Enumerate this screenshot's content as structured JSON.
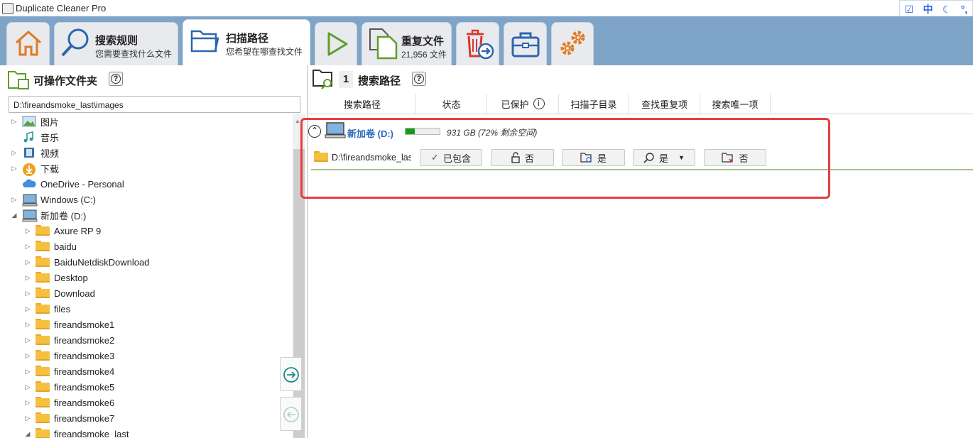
{
  "window": {
    "title": "Duplicate Cleaner Pro"
  },
  "ime": {
    "mode_label": "中"
  },
  "tabs": {
    "home": {
      "icon": "home-icon"
    },
    "search_rules": {
      "title": "搜索规则",
      "subtitle": "您需要查找什么文件",
      "icon": "search-icon"
    },
    "scan_paths": {
      "title": "扫描路径",
      "subtitle": "您希望在哪查找文件",
      "icon": "folder-open-icon"
    },
    "run": {
      "icon": "play-icon"
    },
    "duplicates": {
      "title": "重复文件",
      "subtitle": "21,956 文件",
      "icon": "duplicate-files-icon"
    },
    "remove": {
      "icon": "delete-move-icon"
    },
    "toolbox": {
      "icon": "toolbox-icon"
    },
    "settings": {
      "icon": "gears-icon"
    }
  },
  "left": {
    "title": "可操作文件夹",
    "help": "?",
    "path_value": "D:\\fireandsmoke_last\\images",
    "tree": [
      {
        "label": "图片",
        "icon": "pictures-icon",
        "expander": "▷",
        "level": 0
      },
      {
        "label": "音乐",
        "icon": "music-icon",
        "expander": "",
        "level": 0
      },
      {
        "label": "视频",
        "icon": "video-icon",
        "expander": "▷",
        "level": 0
      },
      {
        "label": "下载",
        "icon": "download-icon",
        "expander": "▷",
        "level": 0
      },
      {
        "label": "OneDrive - Personal",
        "icon": "cloud-icon",
        "expander": "",
        "level": 0
      },
      {
        "label": "Windows (C:)",
        "icon": "computer-icon",
        "expander": "▷",
        "level": 0
      },
      {
        "label": "新加卷 (D:)",
        "icon": "computer-icon",
        "expander": "◢",
        "level": 0
      },
      {
        "label": "Axure RP 9",
        "icon": "folder-icon",
        "expander": "▷",
        "level": 1
      },
      {
        "label": "baidu",
        "icon": "folder-icon",
        "expander": "▷",
        "level": 1
      },
      {
        "label": "BaiduNetdiskDownload",
        "icon": "folder-icon",
        "expander": "▷",
        "level": 1
      },
      {
        "label": "Desktop",
        "icon": "folder-icon",
        "expander": "▷",
        "level": 1
      },
      {
        "label": "Download",
        "icon": "folder-icon",
        "expander": "▷",
        "level": 1
      },
      {
        "label": "files",
        "icon": "folder-icon",
        "expander": "▷",
        "level": 1
      },
      {
        "label": "fireandsmoke1",
        "icon": "folder-icon",
        "expander": "▷",
        "level": 1
      },
      {
        "label": "fireandsmoke2",
        "icon": "folder-icon",
        "expander": "▷",
        "level": 1
      },
      {
        "label": "fireandsmoke3",
        "icon": "folder-icon",
        "expander": "▷",
        "level": 1
      },
      {
        "label": "fireandsmoke4",
        "icon": "folder-icon",
        "expander": "▷",
        "level": 1
      },
      {
        "label": "fireandsmoke5",
        "icon": "folder-icon",
        "expander": "▷",
        "level": 1
      },
      {
        "label": "fireandsmoke6",
        "icon": "folder-icon",
        "expander": "▷",
        "level": 1
      },
      {
        "label": "fireandsmoke7",
        "icon": "folder-icon",
        "expander": "▷",
        "level": 1
      },
      {
        "label": "fireandsmoke_last",
        "icon": "folder-open-icon",
        "expander": "◢",
        "level": 1
      }
    ]
  },
  "right": {
    "count": "1",
    "title": "搜索路径",
    "help": "?",
    "columns": [
      "搜索路径",
      "状态",
      "已保护",
      "扫描子目录",
      "查找重复项",
      "搜索唯一项"
    ],
    "protect_info": "i",
    "drive": {
      "name": "新加卷 (D:)",
      "free_text": "931 GB (72% 剩余空间)",
      "used_fraction": 0.28
    },
    "path": {
      "text": "D:\\fireandsmoke_last",
      "status": "已包含",
      "protected": "否",
      "subdirs": "是",
      "find_dupes": "是",
      "unique": "否"
    }
  },
  "colors": {
    "toolbar": "#7ea4c8",
    "link": "#2c6ab8",
    "highlight": "#e53e3e",
    "usage": "#179b1a"
  }
}
